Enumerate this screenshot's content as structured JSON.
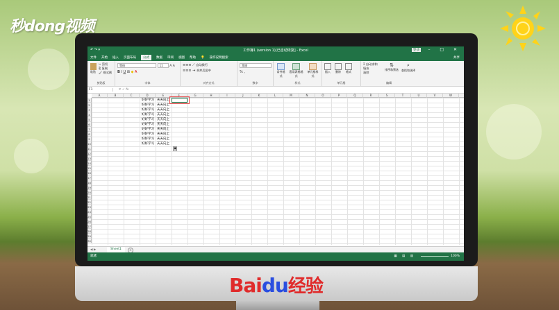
{
  "watermark": {
    "logo_text": "秒dong视频",
    "brand_text": "Bai",
    "brand_paw": "du",
    "brand_suffix": "经验"
  },
  "excel": {
    "title": "工作簿1 (version 1)[已自动恢复] - Excel",
    "login_label": "登录",
    "quick_access": "↶  ↷  ▾",
    "tabs": [
      "文件",
      "开始",
      "插入",
      "页面布局",
      "公式",
      "数据",
      "审阅",
      "视图",
      "帮助"
    ],
    "active_tab": "公式",
    "tell_me": "操作说明搜索",
    "share_label": "共享",
    "ribbon": {
      "clipboard": {
        "paste": "粘贴",
        "cut": "✂ 剪切",
        "copy": "⎘ 复制",
        "format_painter": "🖌 格式刷",
        "label": "剪贴板"
      },
      "font": {
        "name": "等线",
        "size": "11",
        "bold": "B",
        "italic": "I",
        "underline": "U",
        "label": "字体"
      },
      "alignment": {
        "wrap": "自动换行",
        "merge": "合并后居中",
        "label": "对齐方式"
      },
      "number": {
        "format": "常规",
        "pct": "% ,",
        "label": "数字"
      },
      "styles": {
        "cond": "条件格式",
        "table": "套用表格格式",
        "cell": "单元格样式",
        "label": "样式"
      },
      "cells": {
        "insert": "插入",
        "delete": "删除",
        "format": "格式",
        "label": "单元格"
      },
      "editing": {
        "autosum": "Σ 自动求和",
        "fill": "填充",
        "clear": "清除",
        "sort": "排序和筛选",
        "find": "查找和选择",
        "label": "编辑"
      }
    },
    "name_box": "F1",
    "fx": "fx",
    "columns": [
      "A",
      "B",
      "C",
      "D",
      "E",
      "F",
      "G",
      "H",
      "I",
      "J",
      "K",
      "L",
      "M",
      "N",
      "O",
      "P",
      "Q",
      "R",
      "S",
      "T",
      "U",
      "V",
      "W",
      "X"
    ],
    "rows": [
      "1",
      "2",
      "3",
      "4",
      "5",
      "6",
      "7",
      "8",
      "9",
      "10",
      "11",
      "12",
      "13",
      "14",
      "15",
      "16",
      "17",
      "18",
      "19",
      "20",
      "21",
      "22",
      "23",
      "24",
      "25",
      "26",
      "27",
      "28",
      "29",
      "30"
    ],
    "cells": [
      {
        "d": "好好学习",
        "e": "天天向上"
      },
      {
        "d": "好好学习",
        "e": "天天向上"
      },
      {
        "d": "好好学习",
        "e": "天天向上"
      },
      {
        "d": "好好学习",
        "e": "天天向上"
      },
      {
        "d": "好好学习",
        "e": "天天向上"
      },
      {
        "d": "好好学习",
        "e": "天天向上"
      },
      {
        "d": "好好学习",
        "e": "天天向上"
      },
      {
        "d": "好好学习",
        "e": "天天向上"
      },
      {
        "d": "好好学习",
        "e": "天天向上"
      },
      {
        "d": "好好学习",
        "e": "天天向上"
      }
    ],
    "sheet_tab": "Sheet1",
    "status": "就绪",
    "zoom": "100%"
  }
}
